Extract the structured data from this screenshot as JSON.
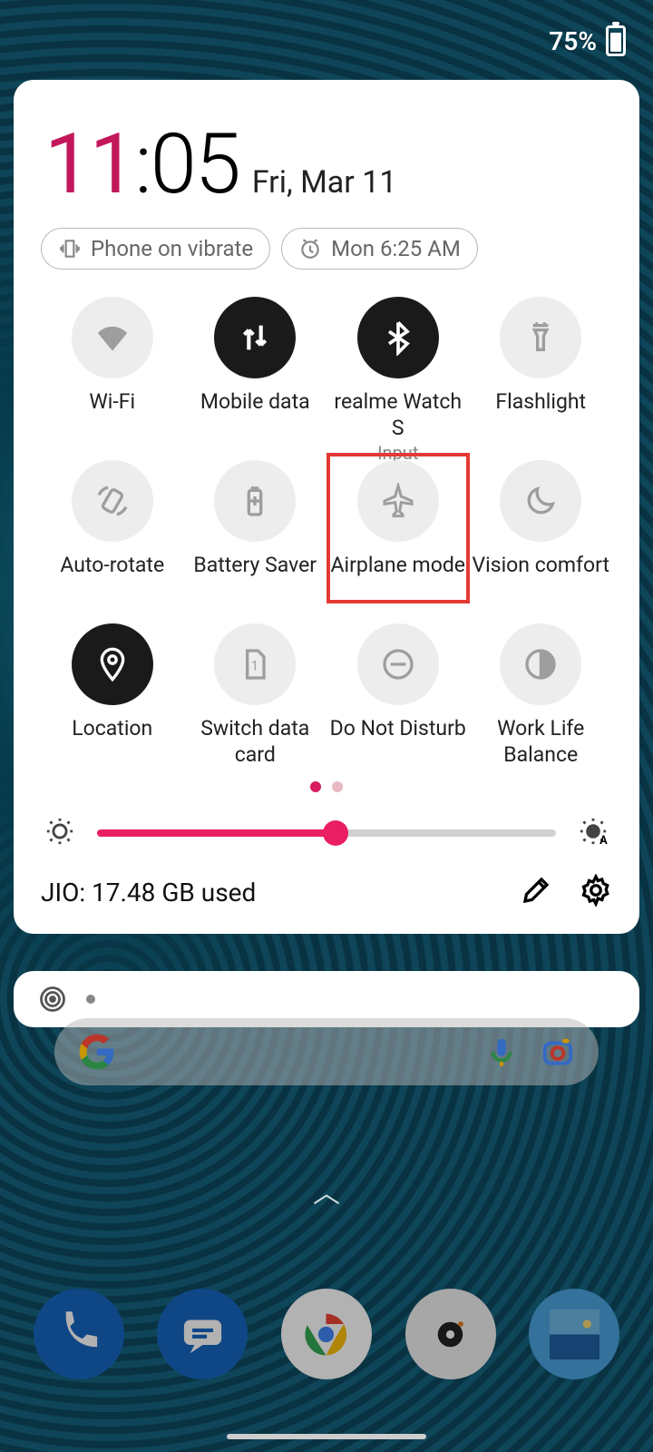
{
  "status": {
    "battery": "75%"
  },
  "clock": {
    "hours": "11",
    "minutes": "05",
    "date": "Fri, Mar 11"
  },
  "chips": {
    "vibrate": "Phone on vibrate",
    "alarm": "Mon 6:25 AM"
  },
  "tiles": [
    {
      "label": "Wi-Fi",
      "sub": "",
      "active": false,
      "highlighted": false,
      "icon": "wifi-icon"
    },
    {
      "label": "Mobile data",
      "sub": "",
      "active": true,
      "highlighted": false,
      "icon": "mobile-data-icon"
    },
    {
      "label": "realme Watch S",
      "sub": "Input",
      "active": true,
      "highlighted": false,
      "icon": "bluetooth-icon"
    },
    {
      "label": "Flashlight",
      "sub": "",
      "active": false,
      "highlighted": false,
      "icon": "flashlight-icon"
    },
    {
      "label": "Auto-rotate",
      "sub": "",
      "active": false,
      "highlighted": false,
      "icon": "auto-rotate-icon"
    },
    {
      "label": "Battery Saver",
      "sub": "",
      "active": false,
      "highlighted": false,
      "icon": "battery-saver-icon"
    },
    {
      "label": "Airplane mode",
      "sub": "",
      "active": false,
      "highlighted": true,
      "icon": "airplane-icon"
    },
    {
      "label": "Vision comfort",
      "sub": "",
      "active": false,
      "highlighted": false,
      "icon": "moon-icon"
    },
    {
      "label": "Location",
      "sub": "",
      "active": true,
      "highlighted": false,
      "icon": "location-icon"
    },
    {
      "label": "Switch data card",
      "sub": "",
      "active": false,
      "highlighted": false,
      "icon": "sim-icon"
    },
    {
      "label": "Do Not Disturb",
      "sub": "",
      "active": false,
      "highlighted": false,
      "icon": "dnd-icon"
    },
    {
      "label": "Work Life Balance",
      "sub": "",
      "active": false,
      "highlighted": false,
      "icon": "work-life-icon"
    }
  ],
  "pager": {
    "current": 0,
    "total": 2
  },
  "brightness": {
    "percent": 52
  },
  "footer": {
    "usage": "JIO: 17.48 GB used"
  },
  "dock_apps": [
    {
      "name": "phone",
      "bg": "#1565c0"
    },
    {
      "name": "messages",
      "bg": "#1565c0"
    },
    {
      "name": "chrome",
      "bg": "#fff"
    },
    {
      "name": "camera",
      "bg": "#eee"
    },
    {
      "name": "gallery",
      "bg": "#4aa3df"
    }
  ]
}
